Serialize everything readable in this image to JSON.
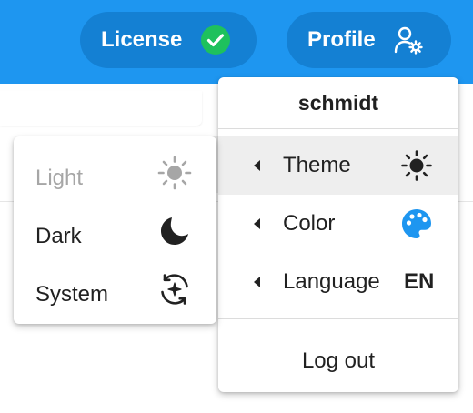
{
  "header": {
    "license_label": "License",
    "license_icon": "check-circle-icon",
    "profile_label": "Profile",
    "profile_icon": "user-gear-icon"
  },
  "profile_menu": {
    "username": "schmidt",
    "items": [
      {
        "label": "Theme",
        "icon": "sun-icon",
        "active": true
      },
      {
        "label": "Color",
        "icon": "palette-icon",
        "icon_color": "#1e96f0"
      },
      {
        "label": "Language",
        "value": "EN"
      }
    ],
    "logout_label": "Log out"
  },
  "theme_menu": {
    "items": [
      {
        "label": "Light",
        "icon": "sun-icon",
        "disabled": true
      },
      {
        "label": "Dark",
        "icon": "moon-icon"
      },
      {
        "label": "System",
        "icon": "auto-sync-icon"
      }
    ]
  },
  "colors": {
    "topbar": "#1e96f0",
    "pill": "#1480d3",
    "check": "#1ec15d",
    "accent": "#1e96f0"
  }
}
